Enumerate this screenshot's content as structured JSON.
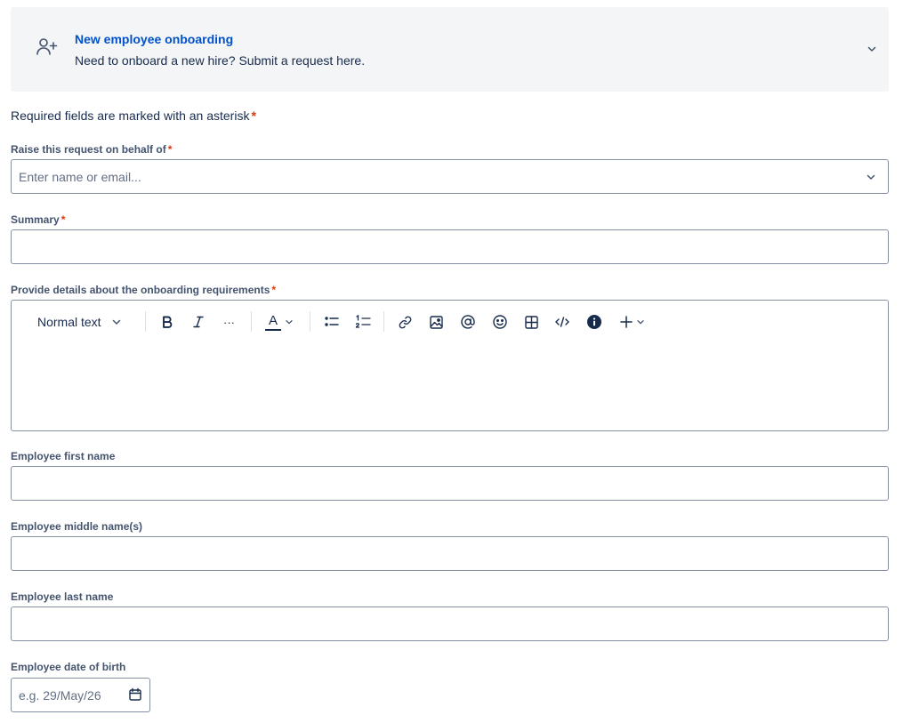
{
  "request_type": {
    "title": "New employee onboarding",
    "description": "Need to onboard a new hire? Submit a request here.",
    "icon": "add-user-icon"
  },
  "required_note": "Required fields are marked with an asterisk",
  "required_marker": "*",
  "fields": {
    "on_behalf": {
      "label": "Raise this request on behalf of",
      "placeholder": "Enter name or email...",
      "value": ""
    },
    "summary": {
      "label": "Summary",
      "value": ""
    },
    "details": {
      "label": "Provide details about the onboarding requirements",
      "value": ""
    },
    "first_name": {
      "label": "Employee first name",
      "value": ""
    },
    "middle_name": {
      "label": "Employee middle name(s)",
      "value": ""
    },
    "last_name": {
      "label": "Employee last name",
      "value": ""
    },
    "dob": {
      "label": "Employee date of birth",
      "placeholder": "e.g. 29/May/26",
      "value": ""
    }
  },
  "toolbar": {
    "text_style": "Normal text",
    "more_label": "···",
    "text_color_label": "A"
  },
  "colors": {
    "accent": "#0052cc",
    "required": "#de350b",
    "card_bg": "#f4f5f7",
    "border": "#8590a2"
  }
}
